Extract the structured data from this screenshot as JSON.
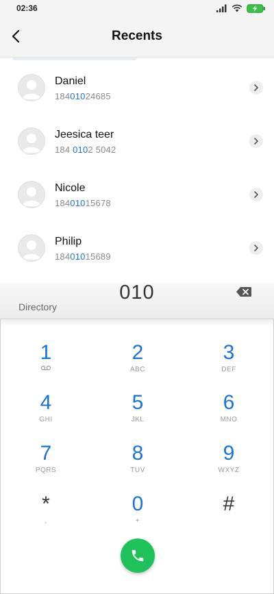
{
  "status_bar": {
    "time": "02:36"
  },
  "header": {
    "title": "Recents"
  },
  "contacts": [
    {
      "name": "Daniel",
      "number_pre": "184",
      "number_match": "010",
      "number_post": "24685"
    },
    {
      "name": "Jeesica teer",
      "number_pre": "184 ",
      "number_match": "010",
      "number_post": "2 5042"
    },
    {
      "name": "Nicole",
      "number_pre": "184",
      "number_match": "010",
      "number_post": "15678"
    },
    {
      "name": "Philip",
      "number_pre": "184",
      "number_match": "010",
      "number_post": "15689"
    }
  ],
  "search": {
    "directory_label": "Directory",
    "dialed": "010"
  },
  "keypad": {
    "keys": [
      {
        "digit": "1",
        "letters": ""
      },
      {
        "digit": "2",
        "letters": "ABC"
      },
      {
        "digit": "3",
        "letters": "DEF"
      },
      {
        "digit": "4",
        "letters": "GHI"
      },
      {
        "digit": "5",
        "letters": "JKL"
      },
      {
        "digit": "6",
        "letters": "MNO"
      },
      {
        "digit": "7",
        "letters": "PQRS"
      },
      {
        "digit": "8",
        "letters": "TUV"
      },
      {
        "digit": "9",
        "letters": "WXYZ"
      },
      {
        "digit": "*",
        "letters": ","
      },
      {
        "digit": "0",
        "letters": "+"
      },
      {
        "digit": "#",
        "letters": ""
      }
    ]
  },
  "colors": {
    "accent": "#1a73d9",
    "call": "#1fc25a",
    "battery": "#3cc14a"
  }
}
